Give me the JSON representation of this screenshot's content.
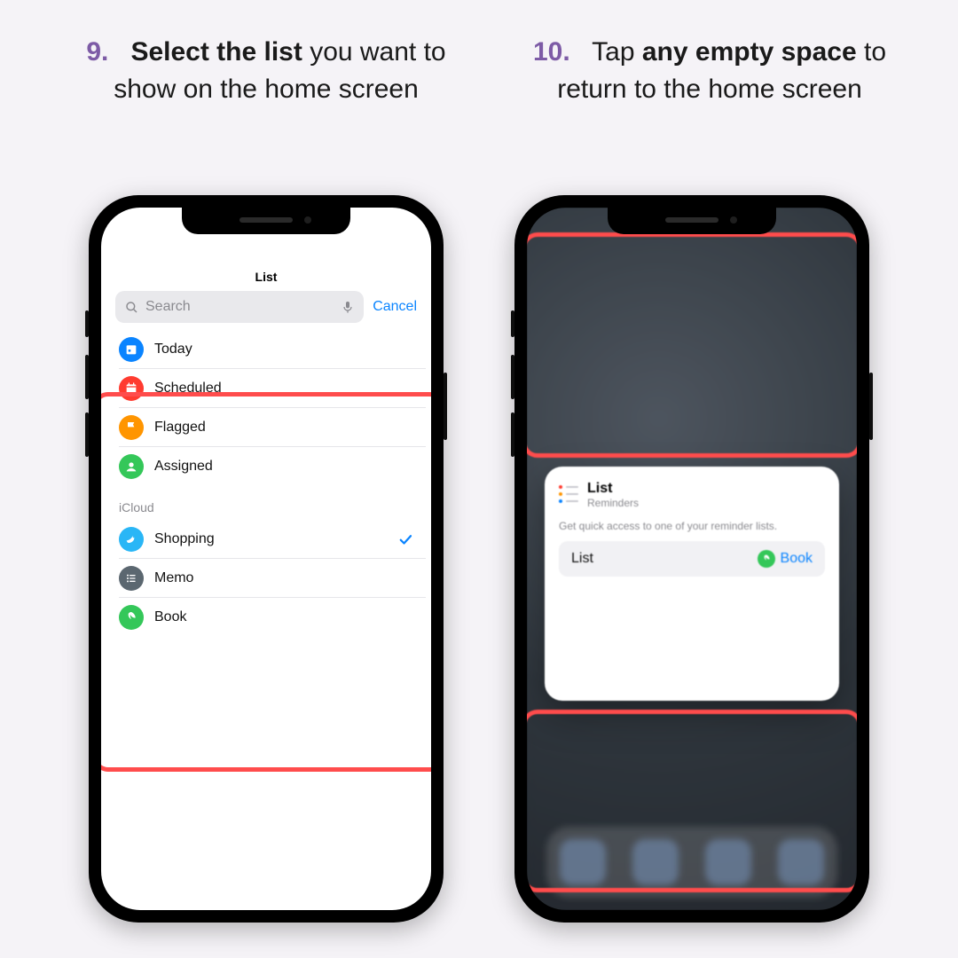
{
  "instructions": {
    "left": {
      "num": "9.",
      "bold": "Select the list",
      "rest1": " you want to show on the home screen"
    },
    "right": {
      "num": "10.",
      "pre": "Tap ",
      "bold": "any empty space",
      "rest1": " to return to the home screen"
    }
  },
  "left_screen": {
    "title": "List",
    "search_placeholder": "Search",
    "cancel": "Cancel",
    "smart": [
      {
        "label": "Today",
        "color": "#0a84ff",
        "icon": "today"
      },
      {
        "label": "Scheduled",
        "color": "#ff3b30",
        "icon": "calendar"
      },
      {
        "label": "Flagged",
        "color": "#ff9500",
        "icon": "flag"
      },
      {
        "label": "Assigned",
        "color": "#34c759",
        "icon": "person"
      }
    ],
    "icloud_header": "iCloud",
    "icloud": [
      {
        "label": "Shopping",
        "color": "#29b6f6",
        "icon": "bird",
        "checked": true
      },
      {
        "label": "Memo",
        "color": "#5b6770",
        "icon": "list",
        "checked": false
      },
      {
        "label": "Book",
        "color": "#34c759",
        "icon": "leaf",
        "checked": false
      }
    ]
  },
  "right_screen": {
    "popover": {
      "title": "List",
      "subtitle": "Reminders",
      "desc": "Get quick access to one of your reminder lists.",
      "pill_left": "List",
      "pill_right": "Book"
    }
  }
}
